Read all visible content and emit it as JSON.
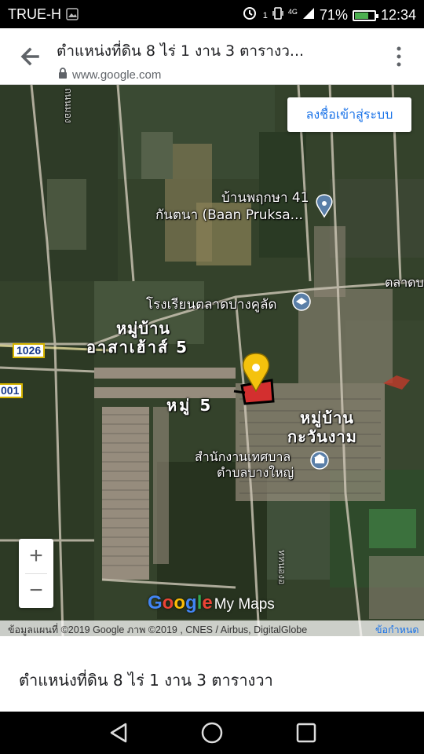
{
  "status_bar": {
    "carrier": "TRUE-H",
    "sim_badge": "1",
    "network": "4G",
    "battery_percent": "71%",
    "battery_level": 0.71,
    "time": "12:34"
  },
  "app_bar": {
    "title": "ตำแหน่งที่ดิน 8 ไร่ 1 งาน 3 ตารางว...",
    "url": "www.google.com",
    "back_icon": "arrow-back-icon",
    "menu_icon": "more-vert-icon"
  },
  "map": {
    "sign_in_label": "ลงชื่อเข้าสู่ระบบ",
    "labels": {
      "poi_ban_pruksa_line1": "บ้านพฤกษา 41",
      "poi_ban_pruksa_line2": "กันตนา (Baan Pruksa...",
      "school": "โรงเรียนตลาดบางคูลัด",
      "village_asa_line1": "หมู่บ้าน",
      "village_asa_line2": "อาสาเฮ้าส์ 5",
      "moo5": "หมู่ 5",
      "village_kawin_line1": "หมู่บ้าน",
      "village_kawin_line2": "กะวันงาม",
      "office_line1": "สำนักงานเทศบาล",
      "office_line2": "ตำบลบางใหญ่",
      "market_edge": "ตลาดบ",
      "road_top": "ถนนมอง",
      "road_bottom": "ทหนองอ"
    },
    "road_shields": [
      "1026",
      "001"
    ],
    "zoom_in": "+",
    "zoom_out": "−",
    "brand_google": "Google",
    "brand_mymaps": "My Maps",
    "attribution": "ข้อมูลแผนที่ ©2019 Google ภาพ ©2019 , CNES / Airbus, DigitalGlobe",
    "terms": "ข้อกำหนด"
  },
  "bottom_sheet": {
    "place_name": "ตำแหน่งที่ดิน 8 ไร่ 1 งาน 3 ตารางวา"
  },
  "nav_bar": {
    "back_icon": "triangle-back-icon",
    "home_icon": "circle-home-icon",
    "recents_icon": "square-recents-icon"
  },
  "colors": {
    "link_blue": "#1a73e8",
    "pin_yellow": "#f4c20d",
    "parcel_red": "#d32f2f",
    "map_dark_green": "#2f3d26"
  }
}
